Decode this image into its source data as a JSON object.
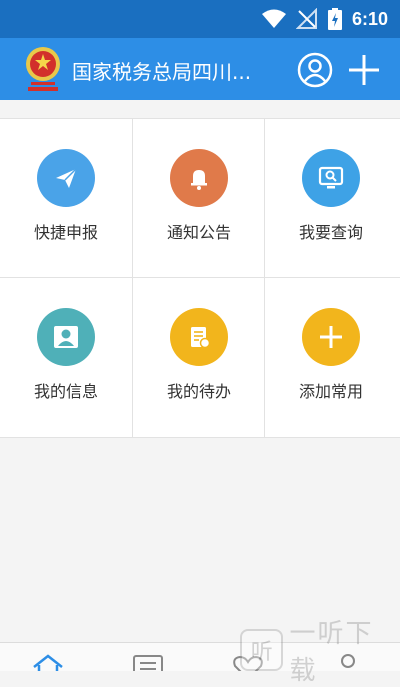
{
  "status_bar": {
    "time": "6:10"
  },
  "app_bar": {
    "title": "国家税务总局四川..."
  },
  "grid": {
    "items": [
      {
        "label": "快捷申报",
        "icon": "paper-plane-icon",
        "color": "#4aa3e8"
      },
      {
        "label": "通知公告",
        "icon": "bell-icon",
        "color": "#e07a4a"
      },
      {
        "label": "我要查询",
        "icon": "monitor-search-icon",
        "color": "#3ea2e6"
      },
      {
        "label": "我的信息",
        "icon": "person-icon",
        "color": "#4fb0b8"
      },
      {
        "label": "我的待办",
        "icon": "document-icon",
        "color": "#f2b51c"
      },
      {
        "label": "添加常用",
        "icon": "plus-icon",
        "color": "#f2b51c"
      }
    ]
  },
  "tab_bar": {
    "tabs": [
      "home-icon",
      "list-icon",
      "heart-icon",
      "profile-icon"
    ]
  },
  "watermark": {
    "logo_glyph": "听",
    "text": "一听下载"
  }
}
